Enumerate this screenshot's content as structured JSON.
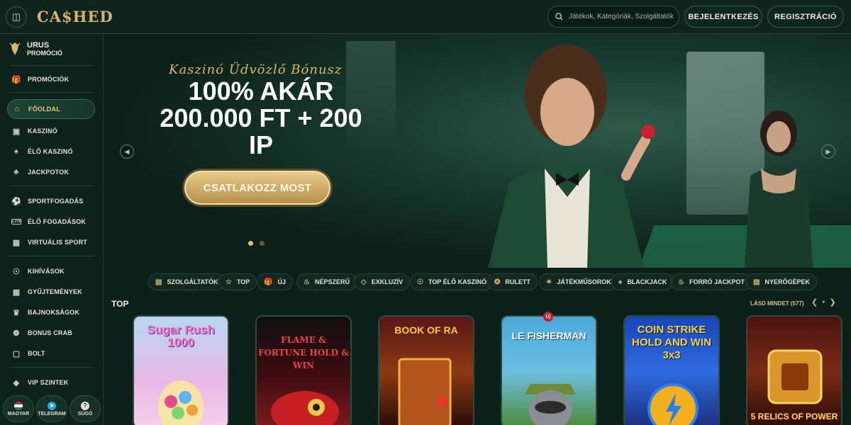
{
  "header": {
    "logo": "CA$HED",
    "search_placeholder": "Játékok, Kategóriák, Szolgáltatók",
    "login_label": "BEJELENTKEZÉS",
    "register_label": "REGISZTRÁCIÓ"
  },
  "sidebar": {
    "promo": {
      "title": "URUS",
      "subtitle": "PROMÓCIÓ"
    },
    "items": [
      {
        "label": "PROMÓCIÓK",
        "icon": "gift-icon"
      },
      {
        "label": "FŐOLDAL",
        "icon": "home-icon"
      },
      {
        "label": "KASZINÓ",
        "icon": "slot-machine-icon"
      },
      {
        "label": "ÉLŐ KASZINÓ",
        "icon": "live-cards-icon"
      },
      {
        "label": "JACKPOTOK",
        "icon": "clover-icon"
      },
      {
        "label": "SPORTFOGADÁS",
        "icon": "ball-icon"
      },
      {
        "label": "ÉLŐ FOGADÁSOK",
        "icon": "live-badge-icon"
      },
      {
        "label": "VIRTUÁLIS SPORT",
        "icon": "monitor-icon"
      },
      {
        "label": "KIHÍVÁSOK",
        "icon": "medal-icon"
      },
      {
        "label": "GYŰJTEMÉNYEK",
        "icon": "collection-icon"
      },
      {
        "label": "BAJNOKSÁGOK",
        "icon": "trophy-icon"
      },
      {
        "label": "BONUS CRAB",
        "icon": "crab-icon"
      },
      {
        "label": "BOLT",
        "icon": "shopping-bag-icon"
      },
      {
        "label": "VIP SZINTEK",
        "icon": "diamond-icon"
      }
    ],
    "bottom": [
      {
        "label": "MAGYAR",
        "icon": "hungary-flag-icon"
      },
      {
        "label": "TELEGRAM",
        "icon": "telegram-icon"
      },
      {
        "label": "SÚGÓ",
        "icon": "help-icon"
      }
    ]
  },
  "banner": {
    "script_title": "Kaszinó Üdvözlő Bónusz",
    "headline_1": "100% AKÁR",
    "headline_2": "200.000 FT + 200",
    "headline_3": "IP",
    "cta": "CSATLAKOZZ MOST",
    "slides_total": 2,
    "slide_active": 1
  },
  "categories": [
    {
      "label": "SZOLGÁLTATÓK",
      "icon": "provider-icon"
    },
    {
      "label": "TOP",
      "icon": "star-icon"
    },
    {
      "label": "ÚJ",
      "icon": "new-gift-icon"
    },
    {
      "label": "NÉPSZERŰ",
      "icon": "flame-icon"
    },
    {
      "label": "EXKLUZÍV",
      "icon": "gem-icon"
    },
    {
      "label": "TOP ÉLŐ KASZINÓ",
      "icon": "award-icon"
    },
    {
      "label": "RULETT",
      "icon": "roulette-icon"
    },
    {
      "label": "JÁTÉKMŰSOROK",
      "icon": "wheel-icon"
    },
    {
      "label": "BLACKJACK",
      "icon": "cards-icon"
    },
    {
      "label": "FORRÓ JACKPOT",
      "icon": "hot-icon"
    },
    {
      "label": "NYERŐGÉPEK",
      "icon": "slots-icon"
    }
  ],
  "top_section": {
    "title": "TOP",
    "see_all": "LÁSD MINDET (577)",
    "new_badge": "Új",
    "games": [
      {
        "name": "Sugar Rush 1000"
      },
      {
        "name": "FLAME & FORTUNE HOLD & WIN"
      },
      {
        "name": "BOOK OF RA"
      },
      {
        "name": "LE FISHERMAN"
      },
      {
        "name": "COIN STRIKE HOLD AND WIN 3x3"
      },
      {
        "name": "5 RELICS OF POWER"
      }
    ]
  },
  "colors": {
    "background": "#0c1f19",
    "accent_gold": "#d9b46a",
    "sidebar": "#0d221b"
  }
}
